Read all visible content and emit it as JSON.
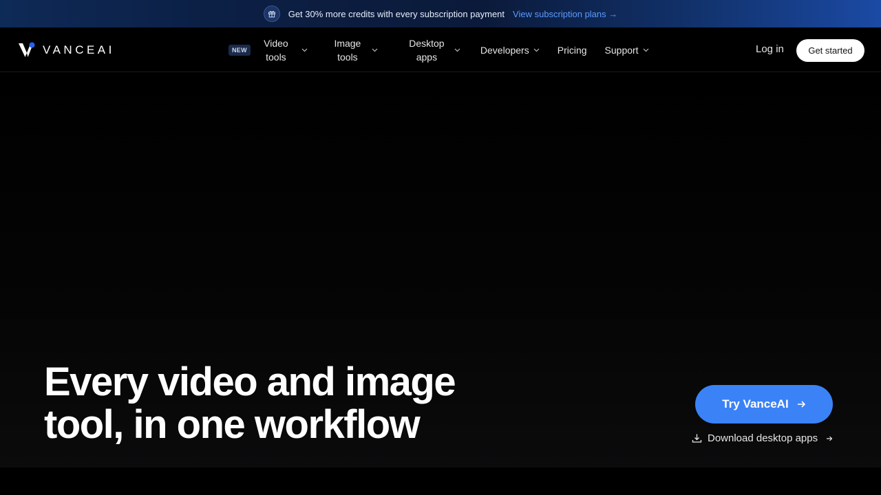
{
  "promo": {
    "text": "Get 30% more credits with every subscription payment",
    "link": "View subscription plans →",
    "icon": "gift-icon"
  },
  "brand": {
    "name": "VANCEAI",
    "accent": "#2563eb"
  },
  "nav": {
    "badge": "NEW",
    "items": [
      {
        "label": "Video tools",
        "dropdown": true
      },
      {
        "label": "Image tools",
        "dropdown": true
      },
      {
        "label": "Desktop apps",
        "dropdown": true
      },
      {
        "label": "Developers",
        "dropdown": true
      },
      {
        "label": "Pricing",
        "dropdown": false
      },
      {
        "label": "Support",
        "dropdown": true
      }
    ],
    "login": "Log in",
    "cta": "Get started"
  },
  "hero": {
    "title": "Every video and image tool, in one workflow",
    "primary_cta": "Try VanceAI",
    "secondary_cta": "Download desktop apps",
    "cta_color": "#3b82f6"
  }
}
